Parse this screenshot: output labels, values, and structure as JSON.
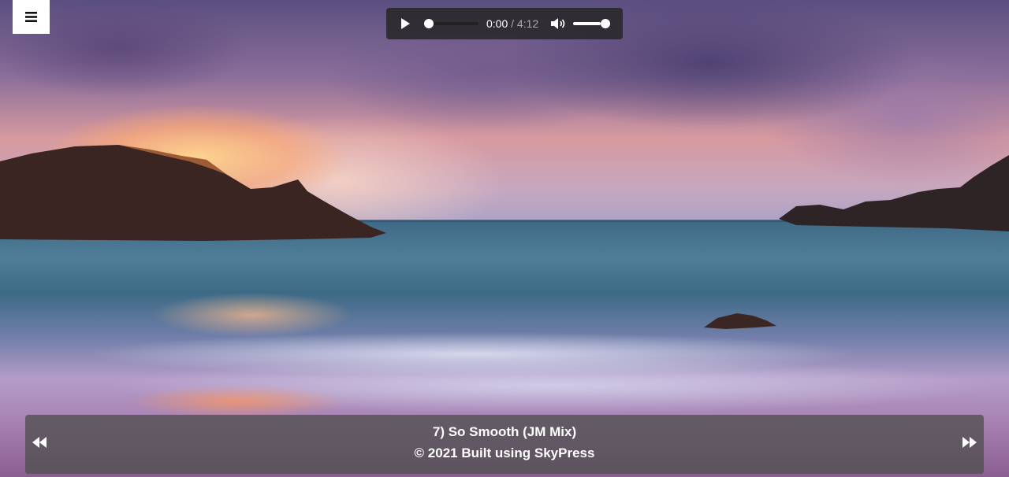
{
  "menu": {
    "icon": "hamburger-icon"
  },
  "player": {
    "current_time": "0:00",
    "separator": "/",
    "duration": "4:12",
    "progress": 0,
    "volume": 1,
    "play_icon": "play-icon",
    "volume_icon": "speaker-icon"
  },
  "footer": {
    "track_title": "7) So Smooth (JM Mix)",
    "copyright": "© 2021 Built using SkyPress",
    "prev_icon": "rewind-icon",
    "next_icon": "fast-forward-icon"
  },
  "colors": {
    "player_bg": "#282828",
    "bar_bg": "#505050",
    "text": "#ffffff"
  }
}
